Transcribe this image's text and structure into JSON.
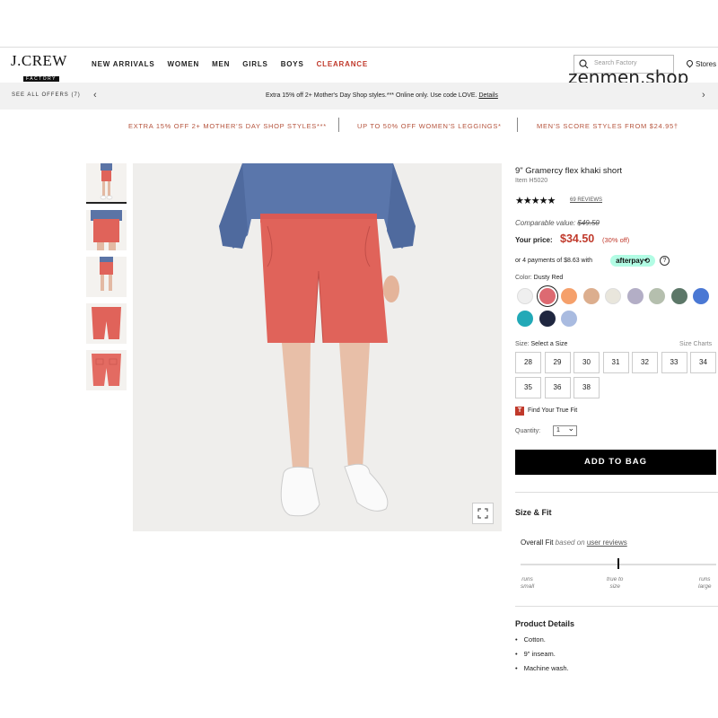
{
  "header": {
    "logo_main": "J.CREW",
    "logo_sub": "FACTORY",
    "nav": [
      "NEW ARRIVALS",
      "WOMEN",
      "MEN",
      "GIRLS",
      "BOYS",
      "CLEARANCE"
    ],
    "search_placeholder": "Search Factory",
    "stores": "Stores",
    "watermark": "zenmen.shop"
  },
  "offers_bar": {
    "see_all": "SEE ALL OFFERS (7)",
    "text": "Extra 15% off 2+ Mother's Day Shop styles.*** Online only. Use code LOVE. ",
    "details": "Details"
  },
  "promos": [
    "EXTRA 15% OFF 2+ MOTHER'S DAY SHOP STYLES***",
    "UP TO 50% OFF WOMEN'S LEGGINGS*",
    "MEN'S SCORE STYLES FROM $24.95†"
  ],
  "product": {
    "title": "9\" Gramercy flex khaki short",
    "item": "Item H5020",
    "stars": "★★★★★",
    "reviews": "69 REVIEWS",
    "comparable_label": "Comparable value: ",
    "comparable_value": "$49.50",
    "your_price_label": "Your price:",
    "price": "$34.50",
    "discount": "(30% off)",
    "payments": "or 4 payments of $8.63 with",
    "afterpay": "afterpay⟲",
    "afterpay_info": "?",
    "color_label": "Color:",
    "color_value": "Dusty Red",
    "swatches": [
      "#efefef",
      "#dd6a72",
      "#f5a06b",
      "#dcae8e",
      "#e9e6dc",
      "#b3aec6",
      "#b5bfae",
      "#5c7768",
      "#4a78d4",
      "#22a9b7",
      "#1f2740",
      "#a9bbe0"
    ],
    "size_label": "Size:",
    "size_value": "Select a Size",
    "size_charts": "Size Charts",
    "sizes": [
      "28",
      "29",
      "30",
      "31",
      "32",
      "33",
      "34",
      "35",
      "36",
      "38"
    ],
    "true_fit_icon": "T",
    "true_fit": "Find Your True Fit",
    "quantity_label": "Quantity:",
    "quantity_value": "1",
    "add_to_bag": "ADD TO BAG"
  },
  "size_fit": {
    "heading": "Size & Fit",
    "overall": "Overall Fit ",
    "based_on": "based on ",
    "user_reviews": "user reviews",
    "fit_value": 0.5,
    "runs_small": [
      "runs",
      "small"
    ],
    "true_to_size": [
      "true to",
      "size"
    ],
    "runs_large": [
      "runs",
      "large"
    ]
  },
  "details": {
    "heading": "Product Details",
    "items": [
      "Cotton.",
      "9\" inseam.",
      "Machine wash."
    ]
  }
}
